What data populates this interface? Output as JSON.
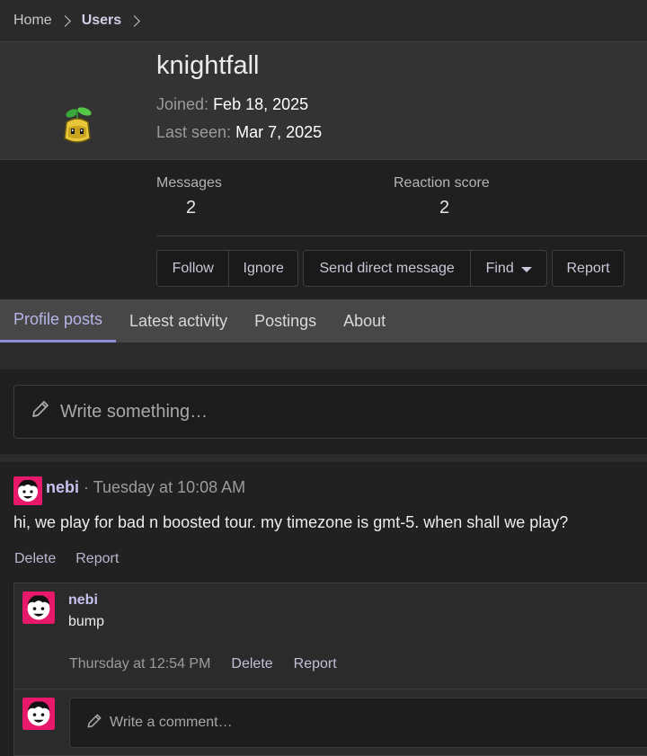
{
  "breadcrumb": {
    "home": "Home",
    "users": "Users"
  },
  "profile": {
    "username": "knightfall",
    "joined_label": "Joined:",
    "joined_value": "Feb 18, 2025",
    "last_seen_label": "Last seen:",
    "last_seen_value": "Mar 7, 2025",
    "avatar_icon": "sprout-bell-sprite-icon"
  },
  "stats": {
    "messages_label": "Messages",
    "messages_value": "2",
    "reaction_label": "Reaction score",
    "reaction_value": "2"
  },
  "actions": {
    "follow": "Follow",
    "ignore": "Ignore",
    "send_dm": "Send direct message",
    "find": "Find",
    "report": "Report"
  },
  "tabs": [
    "Profile posts",
    "Latest activity",
    "Postings",
    "About"
  ],
  "write_placeholder": "Write something…",
  "post": {
    "author": "nebi",
    "separator": " · ",
    "time": "Tuesday at 10:08 AM",
    "body": "hi, we play for bad n boosted tour. my timezone is gmt-5. when shall we play?",
    "delete": "Delete",
    "report": "Report"
  },
  "comment": {
    "author": "nebi",
    "text": "bump",
    "time": "Thursday at 12:54 PM",
    "delete": "Delete",
    "report": "Report"
  },
  "comment_placeholder": "Write a comment…",
  "colors": {
    "accent": "#8f8bd6",
    "link": "#c6c3ee",
    "avatar_pink": "#e8186a"
  }
}
